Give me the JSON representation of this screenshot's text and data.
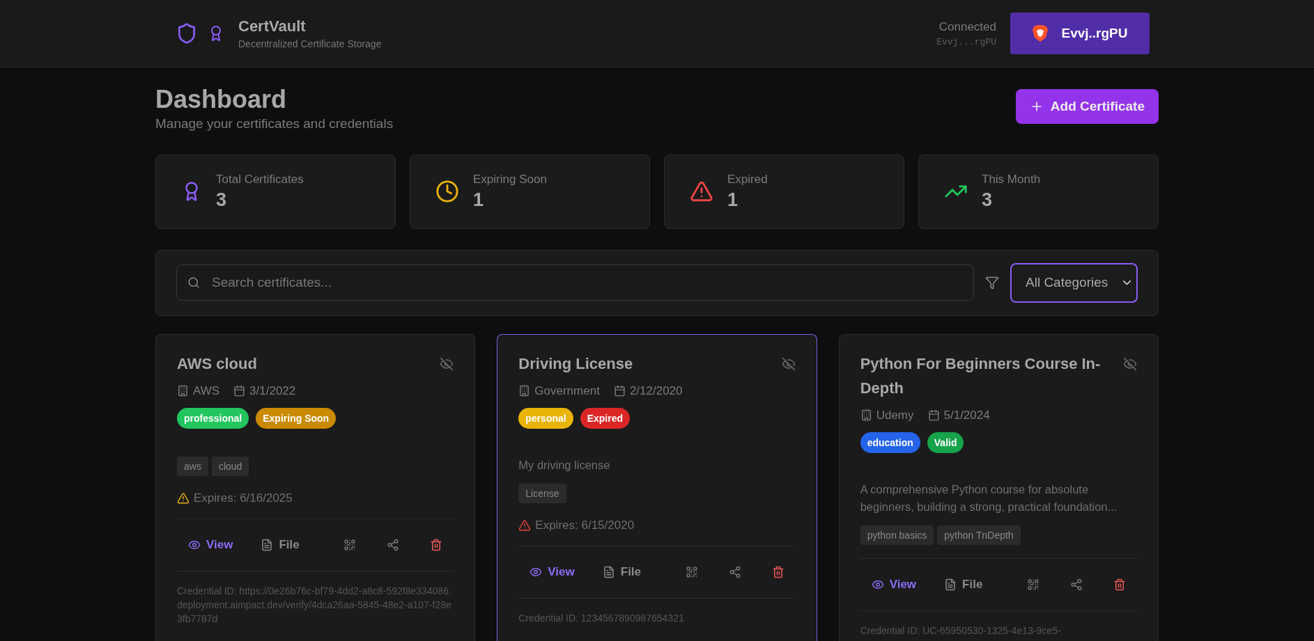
{
  "header": {
    "title": "CertVault",
    "subtitle": "Decentralized Certificate Storage",
    "status": "Connected",
    "address": "Evvj...rgPU",
    "wallet_button": "Evvj..rgPU"
  },
  "page": {
    "title": "Dashboard",
    "subtitle": "Manage your certificates and credentials",
    "add_button": "Add Certificate"
  },
  "stats": [
    {
      "kind": "award",
      "label": "Total Certificates",
      "value": "3"
    },
    {
      "kind": "clock",
      "label": "Expiring Soon",
      "value": "1"
    },
    {
      "kind": "alert",
      "label": "Expired",
      "value": "1"
    },
    {
      "kind": "trend",
      "label": "This Month",
      "value": "3"
    }
  ],
  "search": {
    "placeholder": "Search certificates...",
    "category": "All Categories"
  },
  "certificates": [
    {
      "title": "AWS cloud",
      "issuer": "AWS",
      "date": "3/1/2022",
      "selected": false,
      "category": {
        "label": "professional",
        "color": "#22c55e"
      },
      "status": {
        "label": "Expiring Soon",
        "color": "#ca8a04"
      },
      "tags": [
        "aws",
        "cloud"
      ],
      "expires": {
        "kind": "expiring",
        "text": "Expires: 6/16/2025"
      },
      "actions": [
        "View",
        "File"
      ],
      "credential": "Credential ID: https://0e26b76c-bf79-4dd2-a8c8-592f8e334086.deployment.aimpact.dev/verify/4dca26aa-5845-48e2-a107-f28e3fb7787d"
    },
    {
      "title": "Driving License",
      "issuer": "Government",
      "date": "2/12/2020",
      "selected": true,
      "category": {
        "label": "personal",
        "color": "#eab308"
      },
      "status": {
        "label": "Expired",
        "color": "#dc2626"
      },
      "description": "My driving license",
      "tags": [
        "License"
      ],
      "expires": {
        "kind": "expired",
        "text": "Expires: 6/15/2020"
      },
      "actions": [
        "View",
        "File"
      ],
      "credential": "Credential ID: 1234567890987654321"
    },
    {
      "title": "Python For Beginners Course In-Depth",
      "issuer": "Udemy",
      "date": "5/1/2024",
      "selected": false,
      "category": {
        "label": "education",
        "color": "#2563eb"
      },
      "status": {
        "label": "Valid",
        "color": "#16a34a"
      },
      "description": "A comprehensive Python course for absolute beginners, building a strong, practical foundation...",
      "tags": [
        "python basics",
        "python TnDepth"
      ],
      "actions": [
        "View",
        "File"
      ],
      "credential": "Credential ID: UC-65950530-1325-4e13-9ce5-"
    }
  ]
}
